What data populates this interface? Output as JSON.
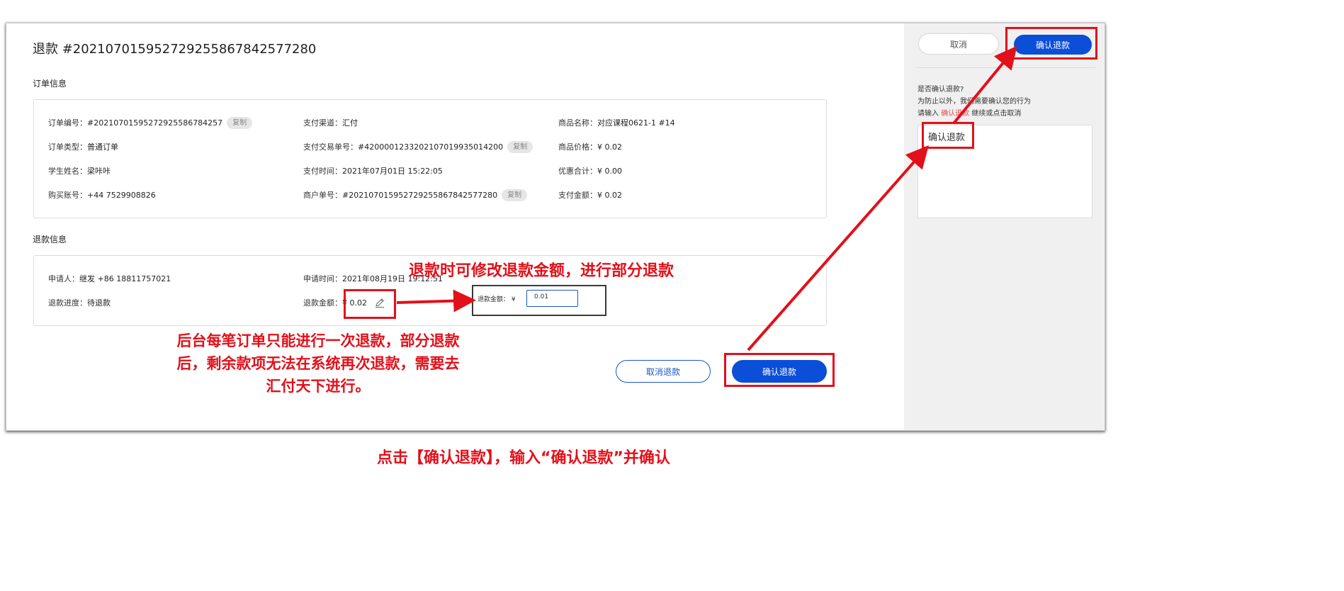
{
  "page": {
    "title": "退款 #20210701595272925586784257​7280",
    "title_clean": "退款 #202107015952729255867842577280"
  },
  "order_info": {
    "section_title": "订单信息",
    "order_no_label": "订单编号：",
    "order_no": "#2021070159527292558678425​7",
    "order_no_clean": "#20210701595272925586784257",
    "copy_label": "复制",
    "order_type_label": "订单类型：",
    "order_type": "普通订单",
    "student_label": "学生姓名：",
    "student": "梁咔咔",
    "account_label": "购买账号：",
    "account": "+44 7529908826",
    "pay_channel_label": "支付渠道：",
    "pay_channel": "汇付",
    "pay_txn_label": "支付交易单号：",
    "pay_txn": "#4200001233202107019935014200",
    "pay_time_label": "支付时间：",
    "pay_time": "2021年07月01日 15:22:05",
    "merchant_no_label": "商户单号：",
    "merchant_no": "#202107015952729255867842577280",
    "product_name_label": "商品名称：",
    "product_name": "对应课程0621-1 #14",
    "product_price_label": "商品价格：",
    "product_price": "¥ 0.02",
    "discount_label": "优惠合计：",
    "discount": "¥ 0.00",
    "paid_label": "支付金额：",
    "paid": "¥ 0.02"
  },
  "refund_info": {
    "section_title": "退款信息",
    "applicant_label": "申请人：",
    "applicant": "继发 +86 18811757021",
    "progress_label": "退款进度：",
    "progress": "待退款",
    "apply_time_label": "申请时间：",
    "apply_time": "2021年08月19日 19:12:51",
    "amount_label": "退款金额：",
    "amount": "¥ 0.02"
  },
  "footer": {
    "cancel_refund": "取消退款",
    "confirm_refund": "确认退款"
  },
  "side_panel": {
    "cancel": "取消",
    "confirm": "确认退款",
    "prompt_line1": "是否确认退款?",
    "prompt_line2": "为防止以外，我们需要确认您的行为",
    "prompt_line3_a": "请输入 ",
    "prompt_line3_kw": "确认退款",
    "prompt_line3_b": " 继续或点击取消",
    "input_value": "确认退款"
  },
  "inset": {
    "label": "退款金额：  ¥",
    "value": "0.01"
  },
  "annotations": {
    "edit_amount": "退款时可修改退款金额，进行部分退款",
    "once_only_line1": "后台每笔订单只能进行一次退款，部分退款",
    "once_only_line2": "后，剩余款项无法在系统再次退款，需要去",
    "once_only_line3": "汇付天下进行。",
    "bottom_instruction": "点击【确认退款】，输入“确认退款”并确认"
  },
  "colors": {
    "primary": "#0b4ed8",
    "annotation_red": "#e2101a",
    "keyword_red": "#e74a4a",
    "side_bg": "#f0f0f0"
  }
}
